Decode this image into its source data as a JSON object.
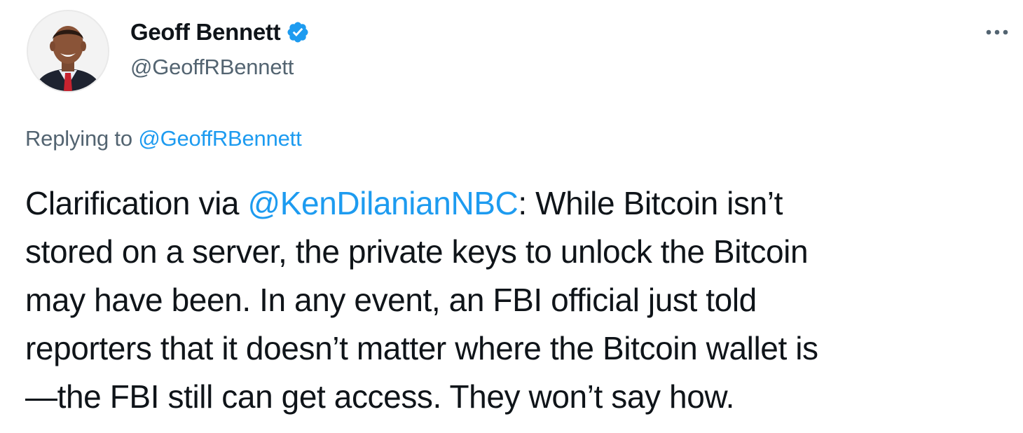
{
  "author": {
    "display_name": "Geoff Bennett",
    "handle": "@GeoffRBennett",
    "verified": true,
    "avatar_icon": "profile-photo"
  },
  "reply": {
    "prefix": "Replying to ",
    "to_handle": "@GeoffRBennett"
  },
  "tweet": {
    "line1_pre": "Clarification via ",
    "line1_mention": "@KenDilanianNBC",
    "line1_post": ": While Bitcoin isn’t",
    "line2": "stored on a server, the private keys to unlock the Bitcoin",
    "line3": "may have been. In any event, an FBI official just told",
    "line4": "reporters that it doesn’t matter where the Bitcoin wallet is",
    "line5": "—the FBI still can get access. They won’t say how."
  },
  "icons": {
    "verified": "verified-badge-icon",
    "more": "more-options-icon"
  },
  "colors": {
    "accent": "#1d9bf0",
    "text": "#0f1419",
    "secondary": "#536471"
  }
}
